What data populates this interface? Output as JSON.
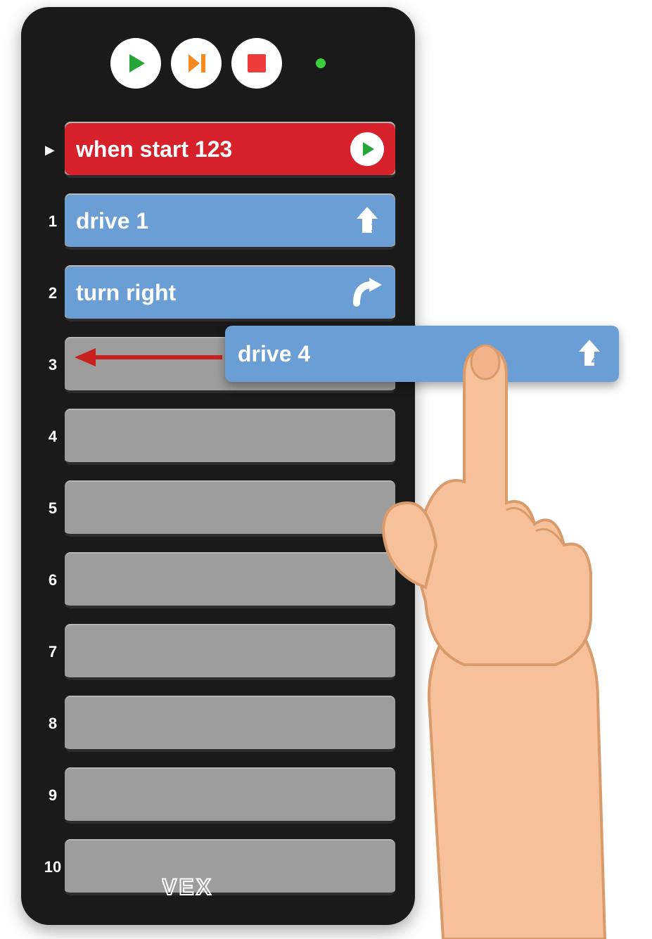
{
  "controls": {
    "play": "play",
    "step": "step",
    "stop": "stop"
  },
  "start_block": {
    "label": "when start 123"
  },
  "rows": [
    {
      "num": "1",
      "label": "drive 1",
      "icon": "arrow-up-1"
    },
    {
      "num": "2",
      "label": "turn right",
      "icon": "curve-right"
    },
    {
      "num": "3",
      "label": "",
      "icon": ""
    },
    {
      "num": "4",
      "label": "",
      "icon": ""
    },
    {
      "num": "5",
      "label": "",
      "icon": ""
    },
    {
      "num": "6",
      "label": "",
      "icon": ""
    },
    {
      "num": "7",
      "label": "",
      "icon": ""
    },
    {
      "num": "8",
      "label": "",
      "icon": ""
    },
    {
      "num": "9",
      "label": "",
      "icon": ""
    },
    {
      "num": "10",
      "label": "",
      "icon": ""
    }
  ],
  "drag_block": {
    "label": "drive 4",
    "icon": "arrow-up-4",
    "icon_num": "4"
  },
  "row1_icon_num": "1",
  "logo": "VEX"
}
